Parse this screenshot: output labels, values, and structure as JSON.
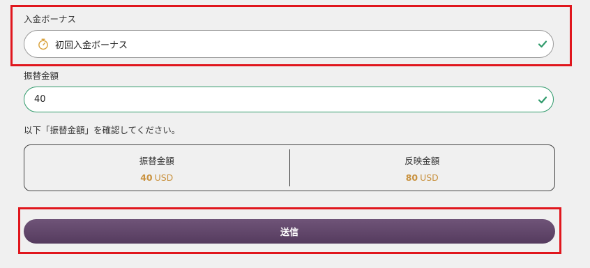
{
  "bonus": {
    "label": "入金ボーナス",
    "selected": "初回入金ボーナス",
    "icon": "stopwatch-icon",
    "status_icon": "check-icon"
  },
  "transfer": {
    "label": "振替金額",
    "value": "40",
    "status_icon": "check-icon"
  },
  "confirm_note": "以下「振替金額」を確認してください。",
  "summary": {
    "transfer_label": "振替金額",
    "transfer_value": "40",
    "transfer_currency": "USD",
    "reflected_label": "反映金額",
    "reflected_value": "80",
    "reflected_currency": "USD"
  },
  "submit_label": "送信",
  "colors": {
    "accent_check": "#2f9a6b",
    "amount_gold": "#c9923f",
    "button": "#5e4467",
    "highlight": "#e0161d"
  }
}
